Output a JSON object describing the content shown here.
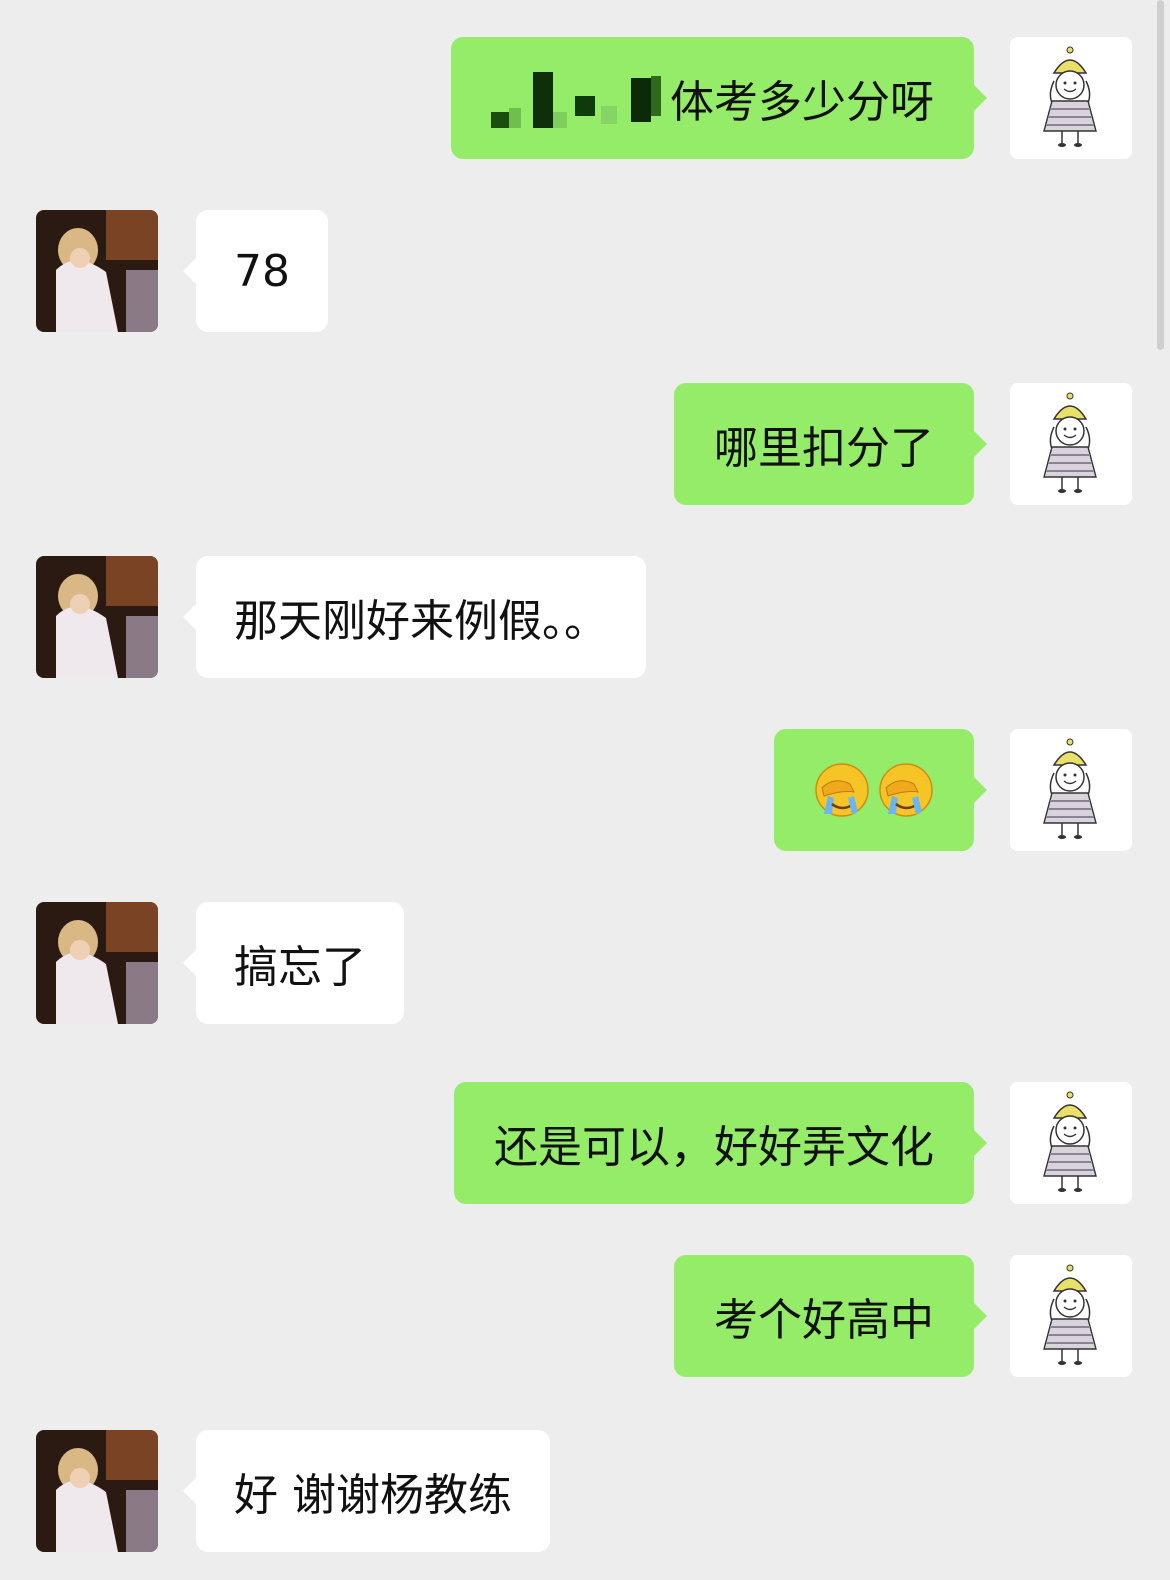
{
  "messages": [
    {
      "side": "right",
      "text": "体考多少分呀",
      "redacted_prefix": true
    },
    {
      "side": "left",
      "text": "78"
    },
    {
      "side": "right",
      "text": "哪里扣分了"
    },
    {
      "side": "left",
      "text": "那天刚好来例假。。"
    },
    {
      "side": "right",
      "emojis": [
        "face-palm-crying-emoji",
        "face-palm-crying-emoji"
      ]
    },
    {
      "side": "left",
      "text": "搞忘了"
    },
    {
      "side": "right",
      "text": "还是可以，好好弄文化"
    },
    {
      "side": "right",
      "text": "考个好高中"
    },
    {
      "side": "left",
      "text": "好 谢谢杨教练"
    }
  ],
  "colors": {
    "background": "#ededed",
    "sent_bubble": "#95ec69",
    "received_bubble": "#ffffff",
    "text": "#111111"
  },
  "avatars": {
    "self": "cartoon-girl-yellow-hat-avatar",
    "contact": "photo-woman-white-dress-avatar"
  }
}
